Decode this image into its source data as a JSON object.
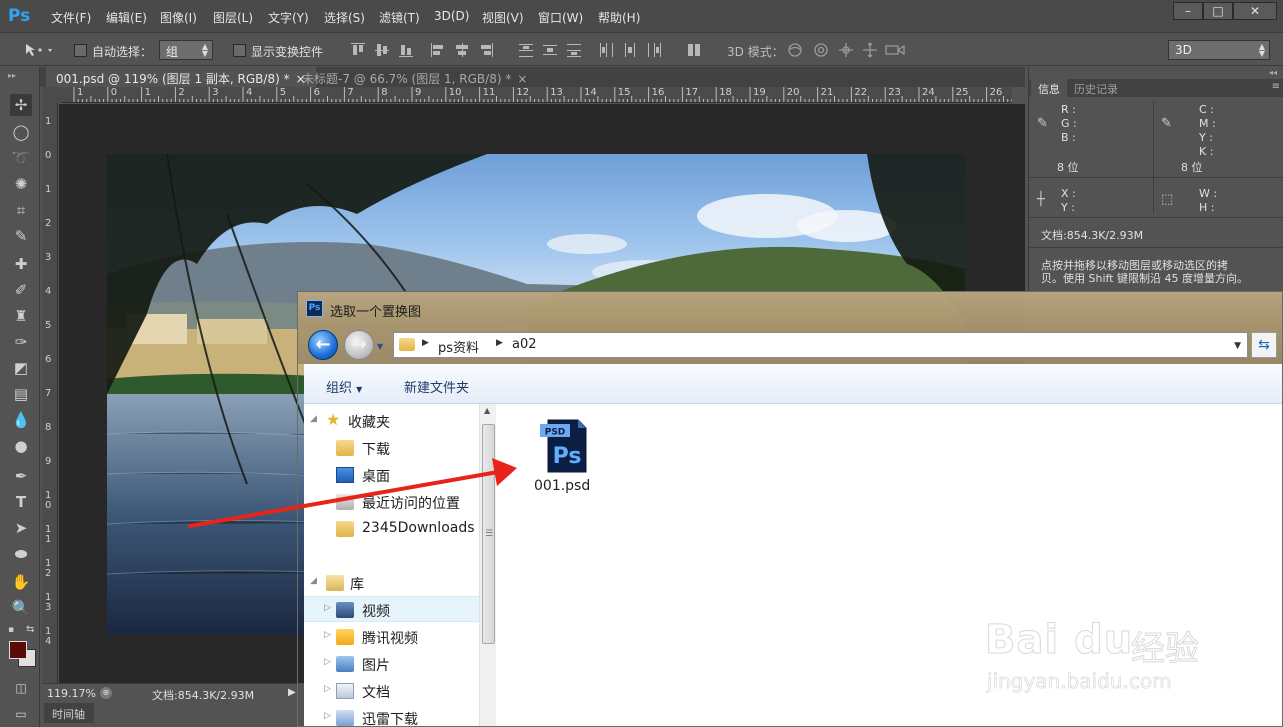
{
  "app": {
    "logo": "Ps",
    "menu": [
      "文件(F)",
      "编辑(E)",
      "图像(I)",
      "图层(L)",
      "文字(Y)",
      "选择(S)",
      "滤镜(T)",
      "3D(D)",
      "视图(V)",
      "窗口(W)",
      "帮助(H)"
    ],
    "window_buttons": [
      "–",
      "□",
      "✕"
    ]
  },
  "options_bar": {
    "auto_select_label": "自动选择：",
    "auto_select_value": "组",
    "show_transform_label": "显示变换控件",
    "mode_3d_label": "3D 模式：",
    "workspace_value": "3D"
  },
  "tabs": [
    {
      "label": "001.psd @ 119% (图层 1 副本, RGB/8) *",
      "close": "×"
    },
    {
      "label": "未标题-7 @ 66.7% (图层 1, RGB/8) *",
      "close": "×"
    }
  ],
  "ruler_h": [
    "1",
    "0",
    "1",
    "2",
    "3",
    "4",
    "5",
    "6",
    "7",
    "8",
    "9",
    "10",
    "11",
    "12",
    "13",
    "14",
    "15",
    "16",
    "17",
    "18",
    "19",
    "20",
    "21",
    "22",
    "23",
    "24",
    "25",
    "26"
  ],
  "ruler_v": [
    "1",
    "0",
    "1",
    "2",
    "3",
    "4",
    "5",
    "6",
    "7",
    "8",
    "9",
    "1\n0",
    "1\n1",
    "1\n2",
    "1\n3",
    "1\n4"
  ],
  "status": {
    "zoom": "119.17%",
    "doc": "文档:854.3K/2.93M",
    "timeline": "时间轴"
  },
  "panel": {
    "tab_info": "信息",
    "tab_history": "历史记录",
    "rgb": [
      "R :",
      "G :",
      "B :"
    ],
    "cmyk": [
      "C :",
      "M :",
      "Y :",
      "K :"
    ],
    "bits_left": "8 位",
    "bits_right": "8 位",
    "xy": [
      "X :",
      "Y :"
    ],
    "wh": [
      "W :",
      "H :"
    ],
    "doc": "文档:854.3K/2.93M",
    "hint_line1": "点按并拖移以移动图层或移动选区的拷",
    "hint_line2": "贝。使用 Shift 键限制沿 45 度增量方向。"
  },
  "dialog": {
    "title": "选取一个置换图",
    "title_icon": "Ps",
    "path": [
      "ps资料",
      "a02"
    ],
    "commands": {
      "organize": "组织",
      "new_folder": "新建文件夹"
    },
    "nav": [
      {
        "label": "收藏夹",
        "icon": "star-icon"
      },
      {
        "label": "下载",
        "icon": "download-folder-icon"
      },
      {
        "label": "桌面",
        "icon": "desktop-icon"
      },
      {
        "label": "最近访问的位置",
        "icon": "recent-places-icon"
      },
      {
        "label": "2345Downloads",
        "icon": "folder-icon"
      },
      {
        "label": "库",
        "icon": "library-icon"
      },
      {
        "label": "视频",
        "icon": "video-library-icon"
      },
      {
        "label": "腾讯视频",
        "icon": "tencent-video-icon"
      },
      {
        "label": "图片",
        "icon": "pictures-library-icon"
      },
      {
        "label": "文档",
        "icon": "documents-library-icon"
      },
      {
        "label": "迅雷下载",
        "icon": "thunder-download-icon"
      }
    ],
    "file": {
      "name": "001.psd",
      "badge": "PSD",
      "glyph": "Ps"
    }
  },
  "watermark": {
    "brand": "Bai du",
    "cn": "经验",
    "url": "jingyan.baidu.com"
  },
  "colors": {
    "accent_ps": "#33a3f4",
    "arrow_red": "#e8231a",
    "dialog_title": "#b9a37c"
  }
}
